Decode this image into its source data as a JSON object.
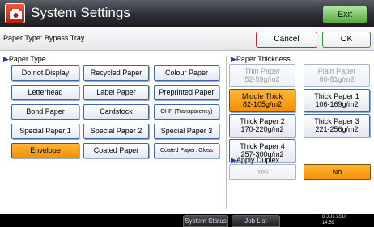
{
  "window": {
    "title": "System Settings",
    "exit_label": "Exit"
  },
  "header": {
    "label": "Paper Type: Bypass Tray",
    "cancel_label": "Cancel",
    "ok_label": "OK"
  },
  "paper_type": {
    "section_label": "Paper Type",
    "buttons": [
      {
        "label": "Do not Display",
        "selected": false
      },
      {
        "label": "Recycled Paper",
        "selected": false
      },
      {
        "label": "Colour Paper",
        "selected": false
      },
      {
        "label": "Letterhead",
        "selected": false
      },
      {
        "label": "Label Paper",
        "selected": false
      },
      {
        "label": "Preprinted Paper",
        "selected": false
      },
      {
        "label": "Bond Paper",
        "selected": false
      },
      {
        "label": "Cardstock",
        "selected": false
      },
      {
        "label": "OHP (Transparency)",
        "selected": false
      },
      {
        "label": "Special Paper 1",
        "selected": false
      },
      {
        "label": "Special Paper 2",
        "selected": false
      },
      {
        "label": "Special Paper 3",
        "selected": false
      },
      {
        "label": "Envelope",
        "selected": true
      },
      {
        "label": "Coated Paper",
        "selected": false
      },
      {
        "label": "Coated Paper: Gloss",
        "selected": false
      }
    ]
  },
  "paper_thickness": {
    "section_label": "Paper Thickness",
    "buttons": [
      {
        "name": "Thin Paper",
        "range": "52-59g/m2",
        "state": "disabled"
      },
      {
        "name": "Plain Paper",
        "range": "60-81g/m2",
        "state": "disabled"
      },
      {
        "name": "Middle Thick",
        "range": "82-105g/m2",
        "state": "selected"
      },
      {
        "name": "Thick Paper 1",
        "range": "106-169g/m2",
        "state": "normal"
      },
      {
        "name": "Thick Paper 2",
        "range": "170-220g/m2",
        "state": "normal"
      },
      {
        "name": "Thick Paper 3",
        "range": "221-256g/m2",
        "state": "normal"
      },
      {
        "name": "Thick Paper 4",
        "range": "257-300g/m2",
        "state": "normal"
      }
    ]
  },
  "duplex": {
    "section_label": "Apply Duplex",
    "yes_label": "Yes",
    "no_label": "No",
    "selected": "No"
  },
  "statusbar": {
    "system_status_label": "System Status",
    "job_list_label": "Job List",
    "date": "8 JUL 2010",
    "time": "14:59"
  },
  "colors": {
    "selected": "#f78f00",
    "button_border": "#3e66a8",
    "exit_green": "#5aa840",
    "cancel_red": "#c3262b",
    "ok_green": "#2b9a2f"
  }
}
